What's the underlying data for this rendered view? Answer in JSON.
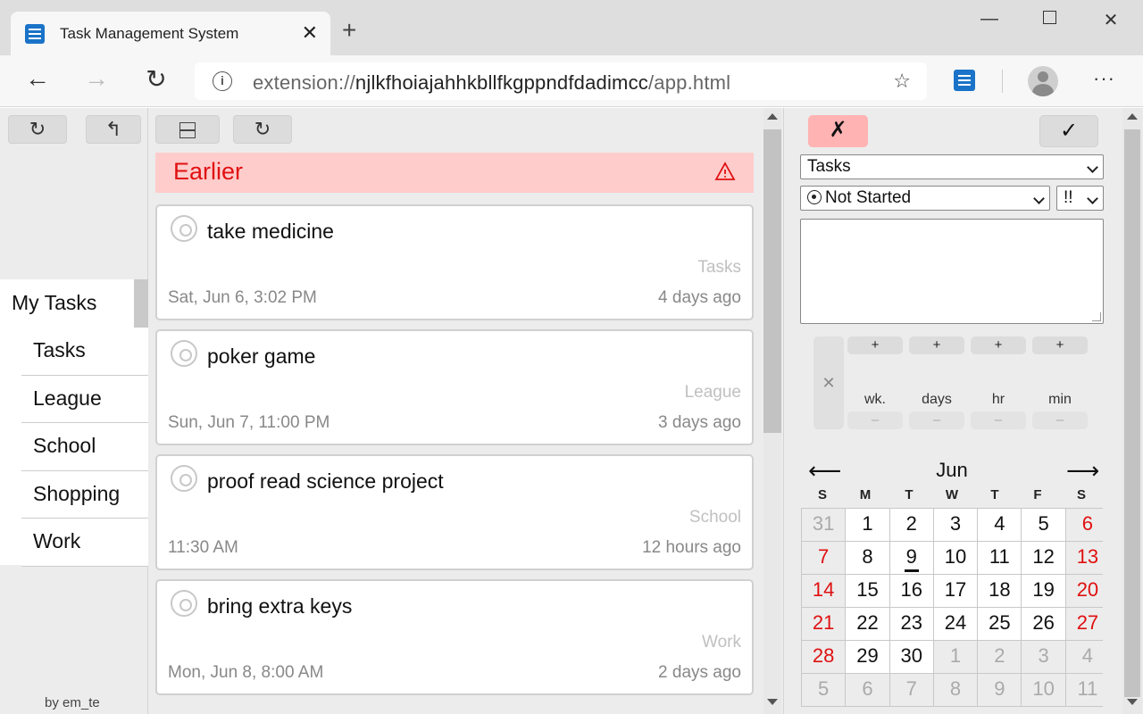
{
  "browser": {
    "tab_title": "Task Management System",
    "tab_close": "✕",
    "new_tab": "+",
    "address_prefix": "extension://",
    "address_host": "njlkfhoiajahhkbllfkgppndfdadimcc",
    "address_path": "/app.html",
    "back": "←",
    "forward": "→",
    "reload": "↻",
    "star": "☆",
    "more": "···",
    "minimize": "—",
    "close": "✕"
  },
  "sidebar": {
    "refresh_label": "↻",
    "undo_label": "↰",
    "header": "My Tasks",
    "items": [
      {
        "label": "Tasks"
      },
      {
        "label": "League"
      },
      {
        "label": "School"
      },
      {
        "label": "Shopping"
      },
      {
        "label": "Work"
      }
    ],
    "credit": "by em_te"
  },
  "middle": {
    "refresh_label": "↻",
    "group_title": "Earlier",
    "tasks": [
      {
        "title": "take medicine",
        "list": "Tasks",
        "date": "Sat, Jun 6, 3:02 PM",
        "ago": "4 days ago"
      },
      {
        "title": "poker game",
        "list": "League",
        "date": "Sun, Jun 7, 11:00 PM",
        "ago": "3 days ago"
      },
      {
        "title": "proof read science project",
        "list": "School",
        "date": "11:30 AM",
        "ago": "12 hours ago"
      },
      {
        "title": "bring extra keys",
        "list": "Work",
        "date": "Mon, Jun 8, 8:00 AM",
        "ago": "2 days ago"
      }
    ]
  },
  "editor": {
    "cancel_label": "✗",
    "ok_label": "✓",
    "list_select": "Tasks",
    "status_select": "Not Started",
    "priority_select": "!!",
    "clear_label": "✕",
    "duration": [
      {
        "plus": "+",
        "label": "wk.",
        "minus": "–"
      },
      {
        "plus": "+",
        "label": "days",
        "minus": "–"
      },
      {
        "plus": "+",
        "label": "hr",
        "minus": "–"
      },
      {
        "plus": "+",
        "label": "min",
        "minus": "–"
      }
    ]
  },
  "calendar": {
    "prev": "⟵",
    "next": "⟶",
    "month": "Jun",
    "dow": [
      "S",
      "M",
      "T",
      "W",
      "T",
      "F",
      "S"
    ],
    "days": [
      {
        "d": "31",
        "t": "other"
      },
      {
        "d": "1",
        "t": ""
      },
      {
        "d": "2",
        "t": ""
      },
      {
        "d": "3",
        "t": ""
      },
      {
        "d": "4",
        "t": ""
      },
      {
        "d": "5",
        "t": ""
      },
      {
        "d": "6",
        "t": "weekend"
      },
      {
        "d": "7",
        "t": "weekend"
      },
      {
        "d": "8",
        "t": ""
      },
      {
        "d": "9",
        "t": "today"
      },
      {
        "d": "10",
        "t": ""
      },
      {
        "d": "11",
        "t": ""
      },
      {
        "d": "12",
        "t": ""
      },
      {
        "d": "13",
        "t": "weekend"
      },
      {
        "d": "14",
        "t": "weekend"
      },
      {
        "d": "15",
        "t": ""
      },
      {
        "d": "16",
        "t": ""
      },
      {
        "d": "17",
        "t": ""
      },
      {
        "d": "18",
        "t": ""
      },
      {
        "d": "19",
        "t": ""
      },
      {
        "d": "20",
        "t": "weekend"
      },
      {
        "d": "21",
        "t": "weekend"
      },
      {
        "d": "22",
        "t": ""
      },
      {
        "d": "23",
        "t": ""
      },
      {
        "d": "24",
        "t": ""
      },
      {
        "d": "25",
        "t": ""
      },
      {
        "d": "26",
        "t": ""
      },
      {
        "d": "27",
        "t": "weekend"
      },
      {
        "d": "28",
        "t": "weekend"
      },
      {
        "d": "29",
        "t": ""
      },
      {
        "d": "30",
        "t": ""
      },
      {
        "d": "1",
        "t": "other"
      },
      {
        "d": "2",
        "t": "other"
      },
      {
        "d": "3",
        "t": "other"
      },
      {
        "d": "4",
        "t": "other"
      },
      {
        "d": "5",
        "t": "other"
      },
      {
        "d": "6",
        "t": "other"
      },
      {
        "d": "7",
        "t": "other"
      },
      {
        "d": "8",
        "t": "other"
      },
      {
        "d": "9",
        "t": "other"
      },
      {
        "d": "10",
        "t": "other"
      },
      {
        "d": "11",
        "t": "other"
      }
    ]
  },
  "colors": {
    "overdue_bg": "#ffcccc",
    "overdue_text": "#e01010",
    "weekend_text": "#e01010",
    "cancel_bg": "#ffb3b3",
    "accent": "#1a73c8"
  }
}
